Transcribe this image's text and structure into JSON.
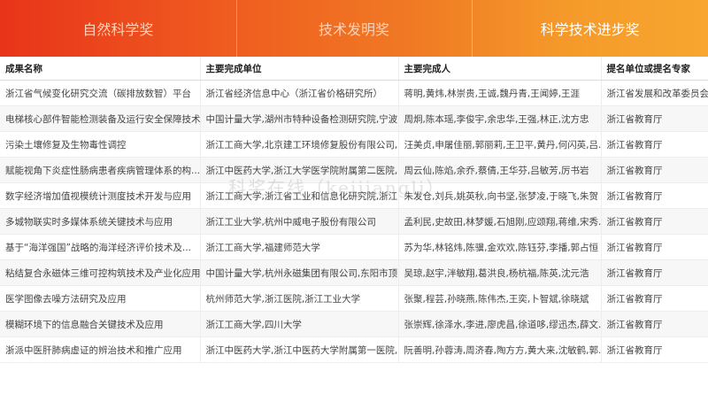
{
  "tabs": [
    {
      "label": "自然科学奖",
      "active": false
    },
    {
      "label": "技术发明奖",
      "active": false
    },
    {
      "label": "科学技术进步奖",
      "active": true
    }
  ],
  "table": {
    "headers": [
      "成果名称",
      "主要完成单位",
      "主要完成人",
      "提名单位或提名专家"
    ],
    "rows": [
      [
        "浙江省气候变化研究交流（碳排放数智）平台",
        "浙江省经济信息中心（浙江省价格研究所）",
        "蒋明,黄炜,林崇贵,王诚,魏丹青,王闻婷,王涯",
        "浙江省发展和改革委员会"
      ],
      [
        "电梯核心部件智能检测装备及运行安全保障技术",
        "中国计量大学,湖州市特种设备检测研究院,宁波...",
        "周炯,陈本瑶,李俊宇,余忠华,王强,林正,沈方忠",
        "浙江省教育厅"
      ],
      [
        "污染土壤修复及生物毒性调控",
        "浙江工商大学,北京建工环境修复股份有限公司,...",
        "汪美贞,申屠佳丽,郭丽莉,王卫平,黄丹,何闪英,吕...",
        "浙江省教育厅"
      ],
      [
        "赋能视角下炎症性肠病患者疾病管理体系的构...",
        "浙江中医药大学,浙江大学医学院附属第二医院,...",
        "周云仙,陈焰,余乔,蔡倩,王华芬,吕敏芳,厉书岩",
        "浙江省教育厅"
      ],
      [
        "数字经济增加值视模统计测度技术开发与应用",
        "浙江工商大学,浙江省工业和信息化研究院,浙江...",
        "朱发仓,刘兵,姚英秋,向书坚,张梦凌,于晓飞,朱贺",
        "浙江省教育厅"
      ],
      [
        "多城物联实时多媒体系统关键技术与应用",
        "浙江工业大学,杭州中威电子股份有限公司",
        "孟利民,史故田,林梦媛,石旭刚,应颂翔,蒋维,宋秀...",
        "浙江省教育厅"
      ],
      [
        "基于“海洋强国”战略的海洋经济评价技术及...",
        "浙江工商大学,福建师范大学",
        "苏为华,林铭炜,陈骥,金欢欢,陈钰芬,李播,郭占恒",
        "浙江省教育厅"
      ],
      [
        "粘结复合永磁体三维可控构筑技术及产业化应用",
        "中国计量大学,杭州永磁集团有限公司,东阳市顶...",
        "吴琼,赵宇,泮敏翔,葛洪良,杨杭福,陈英,沈元浩",
        "浙江省教育厅"
      ],
      [
        "医学图像去噪方法研究及应用",
        "杭州师范大学,浙江医院,浙江工业大学",
        "张聚,程芸,孙晓燕,陈伟杰,王奕,卜智斌,徐晓斌",
        "浙江省教育厅"
      ],
      [
        "模糊环境下的信息融合关键技术及应用",
        "浙江工商大学,四川大学",
        "张崇辉,徐泽水,李进,廖虎昌,徐道哆,缪迅杰,薛文...",
        "浙江省教育厅"
      ],
      [
        "浙派中医肝肺病虚证的辨治技术和推广应用",
        "浙江中医药大学,浙江中医药大学附属第一医院,...",
        "阮善明,孙蓉涛,周济春,陶方方,黄大来,沈敏鹤,郭...",
        "浙江省教育厅"
      ]
    ]
  },
  "watermark": "科奖在线（keijiangli）"
}
